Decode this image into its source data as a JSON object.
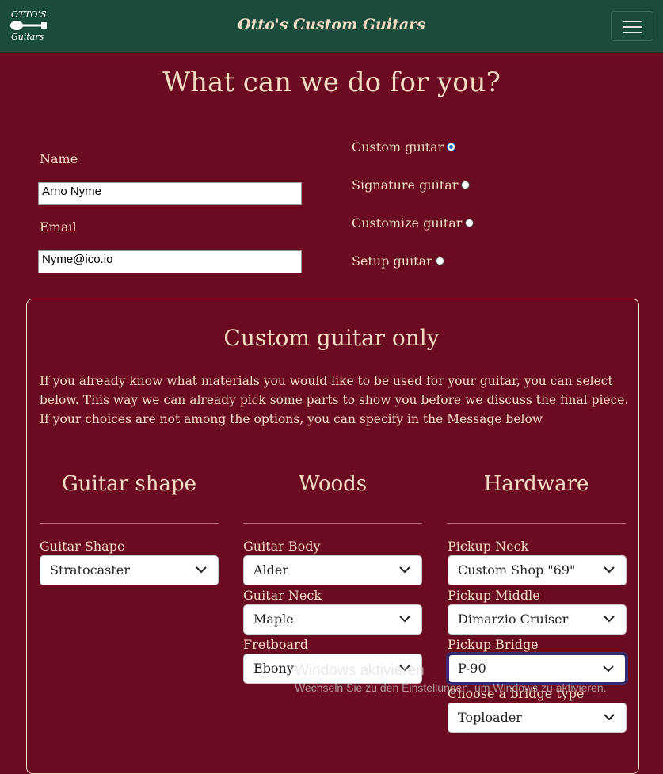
{
  "nav": {
    "logo_top": "OTTO'S",
    "logo_bottom": "Guitars",
    "brand": "Otto's Custom Guitars"
  },
  "form": {
    "title": "What can we do for you?",
    "name_label": "Name",
    "name_value": "Arno Nyme",
    "email_label": "Email",
    "email_value": "Nyme@ico.io",
    "options": [
      {
        "label": "Custom guitar",
        "checked": true
      },
      {
        "label": "Signature guitar",
        "checked": false
      },
      {
        "label": "Customize guitar",
        "checked": false
      },
      {
        "label": "Setup guitar",
        "checked": false
      }
    ]
  },
  "custom": {
    "title": "Custom guitar only",
    "text": "If you already know what materials you would like to be used for your guitar, you can select below. This way we can already pick some parts to show you before we discuss the final piece. If your choices are not among the options, you can specify in the Message below",
    "columns": [
      {
        "heading": "Guitar shape"
      },
      {
        "heading": "Woods"
      },
      {
        "heading": "Hardware"
      }
    ],
    "fields": {
      "shape_label": "Guitar Shape",
      "shape_value": "Stratocaster",
      "body_label": "Guitar Body",
      "body_value": "Alder",
      "neck_label": "Guitar Neck",
      "neck_value": "Maple",
      "fretboard_label": "Fretboard",
      "fretboard_value": "Ebony",
      "pickup_neck_label": "Pickup Neck",
      "pickup_neck_value": "Custom Shop \"69\"",
      "pickup_middle_label": "Pickup Middle",
      "pickup_middle_value": "Dimarzio Cruiser",
      "pickup_bridge_label": "Pickup Bridge",
      "pickup_bridge_value": "P-90",
      "bridge_type_label": "Choose a bridge type",
      "bridge_type_value": "Toploader"
    }
  },
  "watermark": {
    "line1": "Windows aktivieren",
    "line2": "Wechseln Sie zu den Einstellungen, um Windows zu aktivieren."
  },
  "colors": {
    "background": "#6b0b22",
    "navbar": "#1a4b3b",
    "text": "#f3dcc4"
  }
}
